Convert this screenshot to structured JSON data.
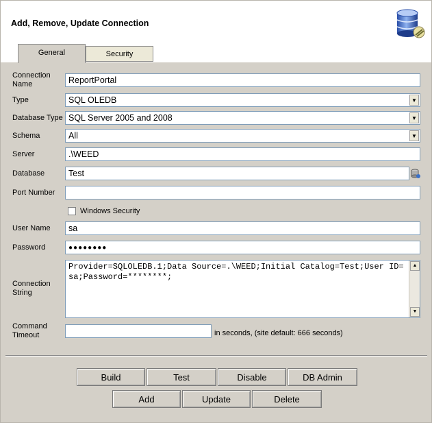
{
  "window": {
    "title": "Add, Remove, Update Connection"
  },
  "tabs": [
    {
      "label": "General",
      "active": true
    },
    {
      "label": "Security",
      "active": false
    }
  ],
  "form": {
    "connection_name": {
      "label_line1": "Connection",
      "label_line2": "Name",
      "value": "ReportPortal"
    },
    "type": {
      "label": "Type",
      "value": "SQL OLEDB"
    },
    "database_type": {
      "label": "Database Type",
      "value": "SQL Server 2005 and 2008"
    },
    "schema": {
      "label": "Schema",
      "value": "All"
    },
    "server": {
      "label": "Server",
      "value": ".\\WEED"
    },
    "database": {
      "label": "Database",
      "value": "Test"
    },
    "port_number": {
      "label": "Port Number",
      "value": ""
    },
    "windows_security": {
      "label": "Windows Security",
      "checked": false
    },
    "user_name": {
      "label": "User Name",
      "value": "sa"
    },
    "password": {
      "label": "Password",
      "value": "●●●●●●●●"
    },
    "connection_string": {
      "label_line1": "Connection",
      "label_line2": "String",
      "value": "Provider=SQLOLEDB.1;Data Source=.\\WEED;Initial Catalog=Test;User ID=sa;Password=********;"
    },
    "command_timeout": {
      "label_line1": "Command",
      "label_line2": "Timeout",
      "value": "",
      "note": "in seconds, (site default: 666 seconds)"
    }
  },
  "buttons": {
    "build": "Build",
    "test": "Test",
    "disable": "Disable",
    "db_admin": "DB Admin",
    "add": "Add",
    "update": "Update",
    "delete": "Delete"
  },
  "icons": {
    "header": "database-icon",
    "database_browse": "database-browse-icon",
    "dropdown": "chevron-down-icon"
  },
  "colors": {
    "panel": "#d4d0c8",
    "field_border": "#7f9db9",
    "header_bg": "#ffffff"
  }
}
